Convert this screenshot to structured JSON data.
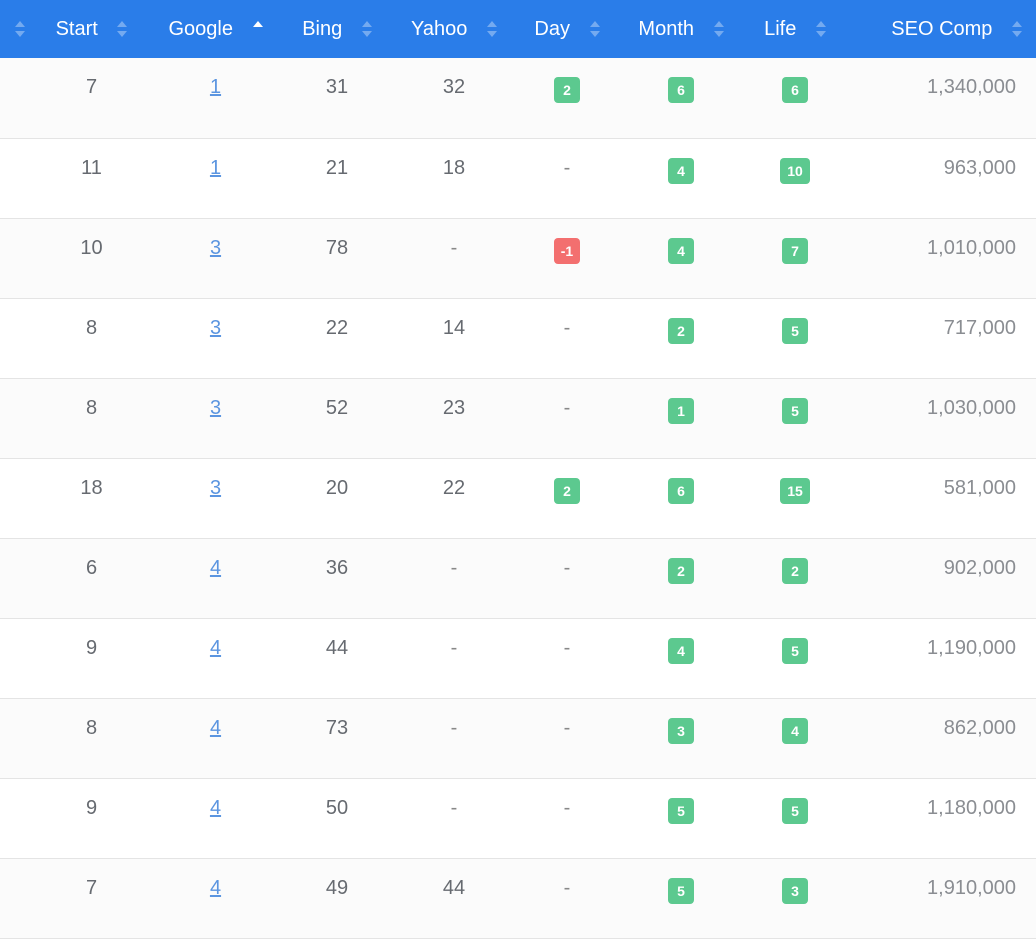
{
  "columns": {
    "start": "Start",
    "google": "Google",
    "bing": "Bing",
    "yahoo": "Yahoo",
    "day": "Day",
    "month": "Month",
    "life": "Life",
    "seo": "SEO Comp"
  },
  "sort_column": "google",
  "sort_direction": "ascending",
  "colors": {
    "header": "#2a7de9",
    "positive_badge": "#5cc98f",
    "negative_badge": "#f36f6f",
    "link": "#5b95e0"
  },
  "rows": [
    {
      "start": "7",
      "google": "1",
      "bing": "31",
      "yahoo": "32",
      "day": "2",
      "month": "6",
      "life": "6",
      "seo": "1,340,000"
    },
    {
      "start": "11",
      "google": "1",
      "bing": "21",
      "yahoo": "18",
      "day": "-",
      "month": "4",
      "life": "10",
      "seo": "963,000"
    },
    {
      "start": "10",
      "google": "3",
      "bing": "78",
      "yahoo": "-",
      "day": "-1",
      "month": "4",
      "life": "7",
      "seo": "1,010,000"
    },
    {
      "start": "8",
      "google": "3",
      "bing": "22",
      "yahoo": "14",
      "day": "-",
      "month": "2",
      "life": "5",
      "seo": "717,000"
    },
    {
      "start": "8",
      "google": "3",
      "bing": "52",
      "yahoo": "23",
      "day": "-",
      "month": "1",
      "life": "5",
      "seo": "1,030,000"
    },
    {
      "start": "18",
      "google": "3",
      "bing": "20",
      "yahoo": "22",
      "day": "2",
      "month": "6",
      "life": "15",
      "seo": "581,000"
    },
    {
      "start": "6",
      "google": "4",
      "bing": "36",
      "yahoo": "-",
      "day": "-",
      "month": "2",
      "life": "2",
      "seo": "902,000"
    },
    {
      "start": "9",
      "google": "4",
      "bing": "44",
      "yahoo": "-",
      "day": "-",
      "month": "4",
      "life": "5",
      "seo": "1,190,000"
    },
    {
      "start": "8",
      "google": "4",
      "bing": "73",
      "yahoo": "-",
      "day": "-",
      "month": "3",
      "life": "4",
      "seo": "862,000"
    },
    {
      "start": "9",
      "google": "4",
      "bing": "50",
      "yahoo": "-",
      "day": "-",
      "month": "5",
      "life": "5",
      "seo": "1,180,000"
    },
    {
      "start": "7",
      "google": "4",
      "bing": "49",
      "yahoo": "44",
      "day": "-",
      "month": "5",
      "life": "3",
      "seo": "1,910,000"
    }
  ]
}
